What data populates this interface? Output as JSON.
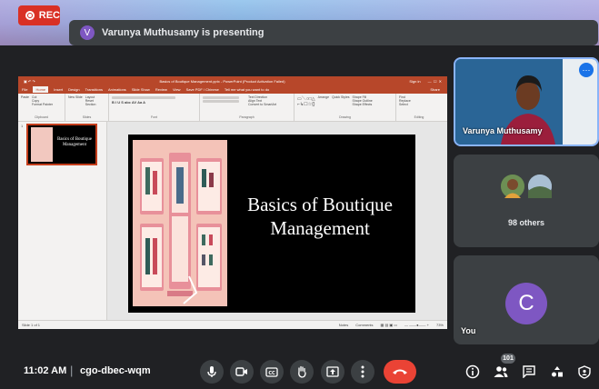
{
  "recording": {
    "label": "REC"
  },
  "presenting_banner": {
    "avatar_letter": "V",
    "text": "Varunya Muthusamy is presenting"
  },
  "shared_screen": {
    "window_title": "Basics of Boutique Management.pptx - PowerPoint (Product Activation Failed)",
    "account": "Sign in",
    "tabs": [
      "File",
      "Home",
      "Insert",
      "Design",
      "Transitions",
      "Animations",
      "Slide Show",
      "Review",
      "View",
      "Save PDF / Chinese",
      "Tell me what you want to do"
    ],
    "active_tab": "Home",
    "share_label": "Share",
    "ribbon_groups": [
      "Clipboard",
      "Slides",
      "Font",
      "Paragraph",
      "Drawing",
      "Editing"
    ],
    "ribbon_labels": {
      "paste": "Paste",
      "cut": "Cut",
      "copy": "Copy",
      "format_painter": "Format Painter",
      "new_slide": "New Slide",
      "layout": "Layout",
      "reset": "Reset",
      "section": "Section",
      "text_direction": "Text Direction",
      "align_text": "Align Text",
      "convert_smartart": "Convert to SmartArt",
      "arrange": "Arrange",
      "quick_styles": "Quick Styles",
      "shape_fill": "Shape Fill",
      "shape_outline": "Shape Outline",
      "shape_effects": "Shape Effects",
      "find": "Find",
      "replace": "Replace",
      "select": "Select"
    },
    "thumbnail": {
      "number": "1",
      "title_line1": "Basics of Boutique",
      "title_line2": "Management"
    },
    "slide": {
      "title_line1": "Basics of Boutique",
      "title_line2": "Management"
    },
    "status": {
      "slide_counter": "Slide 1 of 1",
      "notes": "Notes",
      "comments": "Comments",
      "zoom": "73%"
    }
  },
  "participants": [
    {
      "name": "Varunya Muthusamy",
      "more_icon": "more-vert-icon"
    },
    {
      "name": "98 others"
    },
    {
      "name": "You",
      "avatar_letter": "C"
    }
  ],
  "bottom_bar": {
    "time": "11:02 AM",
    "separator": "|",
    "meeting_code": "cgo-dbec-wqm",
    "controls": [
      "mic-icon",
      "camera-icon",
      "captions-icon",
      "raise-hand-icon",
      "present-icon",
      "more-icon",
      "hang-up-icon"
    ],
    "right_controls": [
      "info-icon",
      "people-icon",
      "chat-icon",
      "activities-icon",
      "host-controls-icon"
    ],
    "people_count": "101"
  },
  "colors": {
    "record_red": "#d93025",
    "hangup_red": "#ea4335",
    "accent_blue": "#1a73e8",
    "powerpoint_orange": "#b7472a",
    "avatar_purple": "#7e57c2"
  }
}
